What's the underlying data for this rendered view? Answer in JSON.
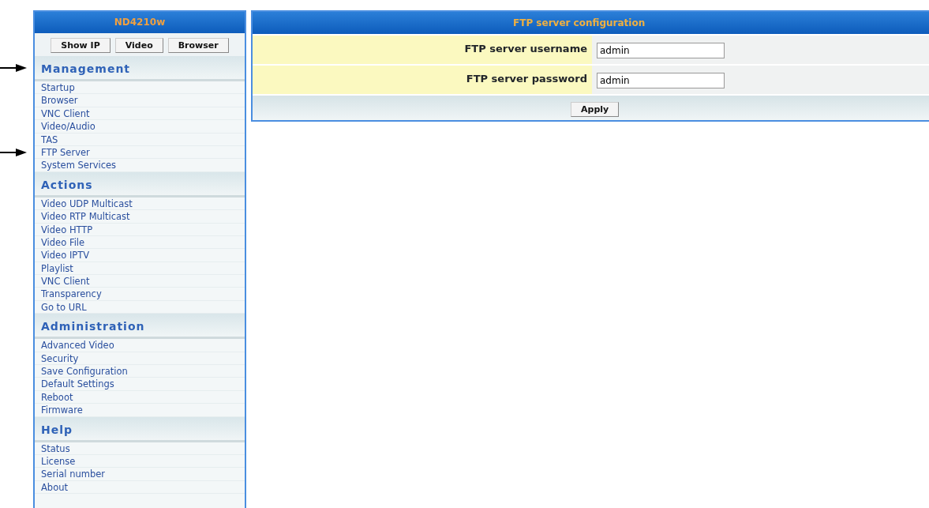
{
  "sidebar": {
    "title": "ND4210w",
    "buttons": [
      "Show IP",
      "Video",
      "Browser"
    ],
    "sections": [
      {
        "heading": "Management",
        "pointed": true,
        "items": [
          {
            "label": "Startup",
            "pointed": false
          },
          {
            "label": "Browser",
            "pointed": false
          },
          {
            "label": "VNC Client",
            "pointed": false
          },
          {
            "label": "Video/Audio",
            "pointed": false
          },
          {
            "label": "TAS",
            "pointed": false
          },
          {
            "label": "FTP Server",
            "pointed": true
          },
          {
            "label": "System Services",
            "pointed": false
          }
        ]
      },
      {
        "heading": "Actions",
        "pointed": false,
        "items": [
          {
            "label": "Video UDP Multicast",
            "pointed": false
          },
          {
            "label": "Video RTP Multicast",
            "pointed": false
          },
          {
            "label": "Video HTTP",
            "pointed": false
          },
          {
            "label": "Video File",
            "pointed": false
          },
          {
            "label": "Video IPTV",
            "pointed": false
          },
          {
            "label": "Playlist",
            "pointed": false
          },
          {
            "label": "VNC Client",
            "pointed": false
          },
          {
            "label": "Transparency",
            "pointed": false
          },
          {
            "label": "Go to URL",
            "pointed": false
          }
        ]
      },
      {
        "heading": "Administration",
        "pointed": false,
        "items": [
          {
            "label": "Advanced Video",
            "pointed": false
          },
          {
            "label": "Security",
            "pointed": false
          },
          {
            "label": "Save Configuration",
            "pointed": false
          },
          {
            "label": "Default Settings",
            "pointed": false
          },
          {
            "label": "Reboot",
            "pointed": false
          },
          {
            "label": "Firmware",
            "pointed": false
          }
        ]
      },
      {
        "heading": "Help",
        "pointed": false,
        "items": [
          {
            "label": "Status",
            "pointed": false
          },
          {
            "label": "License",
            "pointed": false
          },
          {
            "label": "Serial number",
            "pointed": false
          },
          {
            "label": "About",
            "pointed": false
          }
        ]
      }
    ]
  },
  "panel": {
    "title": "FTP server configuration",
    "fields": [
      {
        "label": "FTP server username",
        "value": "admin"
      },
      {
        "label": "FTP server password",
        "value": "admin"
      }
    ],
    "button": "Apply"
  }
}
